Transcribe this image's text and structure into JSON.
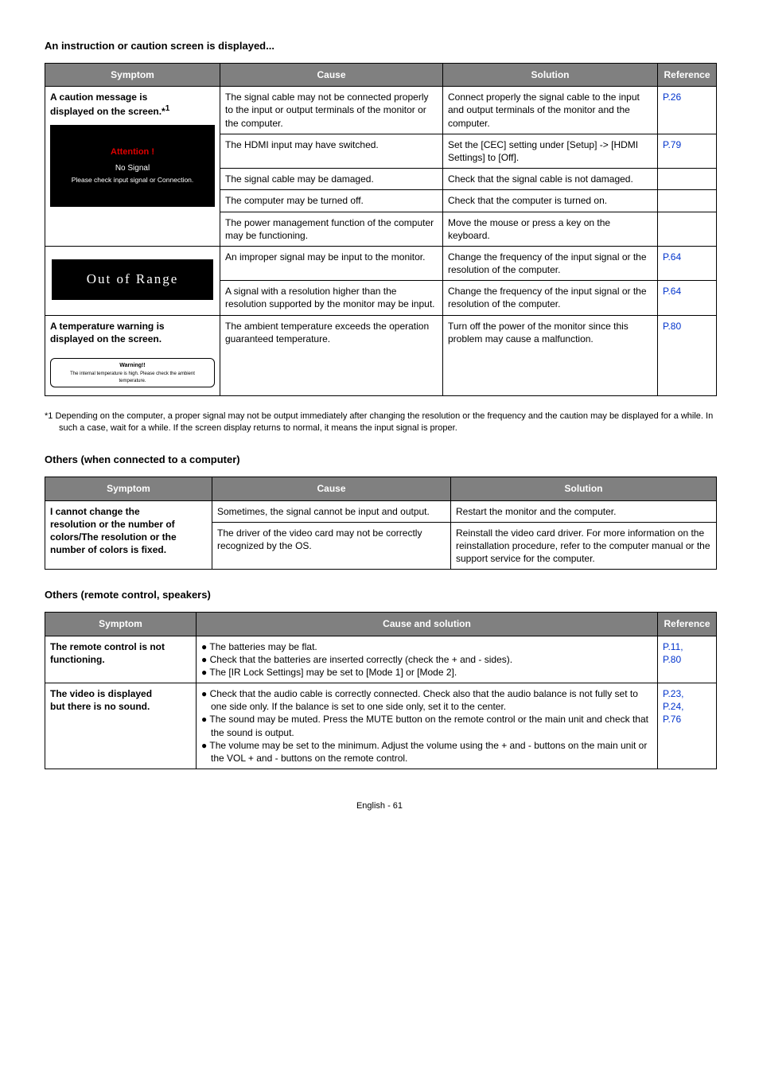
{
  "sections": {
    "s1_title": "An instruction or caution screen is displayed...",
    "s2_title": "Others (when connected to a computer)",
    "s3_title": "Others (remote control, speakers)"
  },
  "headers": {
    "symptom": "Symptom",
    "cause": "Cause",
    "solution": "Solution",
    "reference": "Reference",
    "cause_solution": "Cause and solution"
  },
  "t1": {
    "r1": {
      "symptom_line1": "A caution message is",
      "symptom_line2": "displayed on the screen.*",
      "symptom_sup": "1",
      "osd_title": "Attention !",
      "osd_line1": "No Signal",
      "osd_line2": "Please check input signal or Connection.",
      "cause": "The signal cable may not be connected properly to the input or output terminals of the monitor or the computer.",
      "solution": "Connect properly the signal cable to the input and output terminals of the monitor and the computer.",
      "ref": "P.26"
    },
    "r2": {
      "cause": "The HDMI input may have switched.",
      "solution": "Set the [CEC] setting under [Setup] -> [HDMI Settings] to [Off].",
      "ref": "P.79"
    },
    "r3": {
      "cause": "The signal cable may be damaged.",
      "solution": "Check that the signal cable is not damaged.",
      "ref": ""
    },
    "r4": {
      "cause": "The computer may be turned off.",
      "solution": "Check that the computer is turned on.",
      "ref": ""
    },
    "r5": {
      "cause": "The power management function of the computer may be functioning.",
      "solution": "Move the mouse or press a key on the keyboard.",
      "ref": ""
    },
    "r6": {
      "symptom_osd": "Out of Range",
      "cause": "An improper signal may be input to the monitor.",
      "solution": "Change the frequency of the input signal or the resolution of the computer.",
      "ref": "P.64"
    },
    "r7": {
      "cause": "A signal with a resolution higher than the resolution supported by the monitor may be input.",
      "solution": "Change the frequency of the input signal or the resolution of the computer.",
      "ref": "P.64"
    },
    "r8": {
      "symptom_line1": "A temperature warning is",
      "symptom_line2": "displayed on the screen.",
      "osd_title": "Warning!!",
      "osd_body": "The internal temperature is high. Please check the ambient temperature.",
      "cause": "The ambient temperature exceeds the operation guaranteed temperature.",
      "solution": "Turn off the power of the monitor since this problem may cause a malfunction.",
      "ref": "P.80"
    }
  },
  "footnote1": "*1   Depending on the computer, a proper signal may not be output immediately after changing the resolution or the frequency and the caution may be displayed for a while. In such a case, wait for a while. If the screen display returns to normal, it means the input signal is proper.",
  "t2": {
    "r1": {
      "symptom_l1": "I cannot change the",
      "symptom_l2": "resolution or the number of",
      "symptom_l3": "colors/The resolution or the",
      "symptom_l4": "number of colors is fixed.",
      "cause": "Sometimes, the signal cannot be input and output.",
      "solution": "Restart the monitor and the computer."
    },
    "r2": {
      "cause": "The driver of the video card may not be correctly recognized by the OS.",
      "solution": "Reinstall the video card driver. For more information on the reinstallation procedure, refer to the computer manual or the support service for the computer."
    }
  },
  "t3": {
    "r1": {
      "symptom_l1": "The remote control is not",
      "symptom_l2": "functioning.",
      "b1": "● The batteries may be flat.",
      "b2": "● Check that the batteries are inserted correctly (check the + and - sides).",
      "b3": "● The [IR Lock Settings] may be set to [Mode 1] or [Mode 2].",
      "ref1": "P.11,",
      "ref2": "P.80"
    },
    "r2": {
      "symptom_l1": "The video is displayed",
      "symptom_l2": "but there is no sound.",
      "b1": "● Check that the audio cable is correctly connected. Check also that the audio balance is not fully set to one side only. If the balance is set to one side only, set it to the center.",
      "b2": "● The sound may be muted. Press the MUTE button on the remote control or the main unit and check that the sound is output.",
      "b3": "● The volume may be set to the minimum. Adjust the volume using the + and - buttons on the main unit or the VOL + and - buttons on the remote control.",
      "ref1": "P.23,",
      "ref2": "P.24,",
      "ref3": "P.76"
    }
  },
  "footer": "English - 61"
}
